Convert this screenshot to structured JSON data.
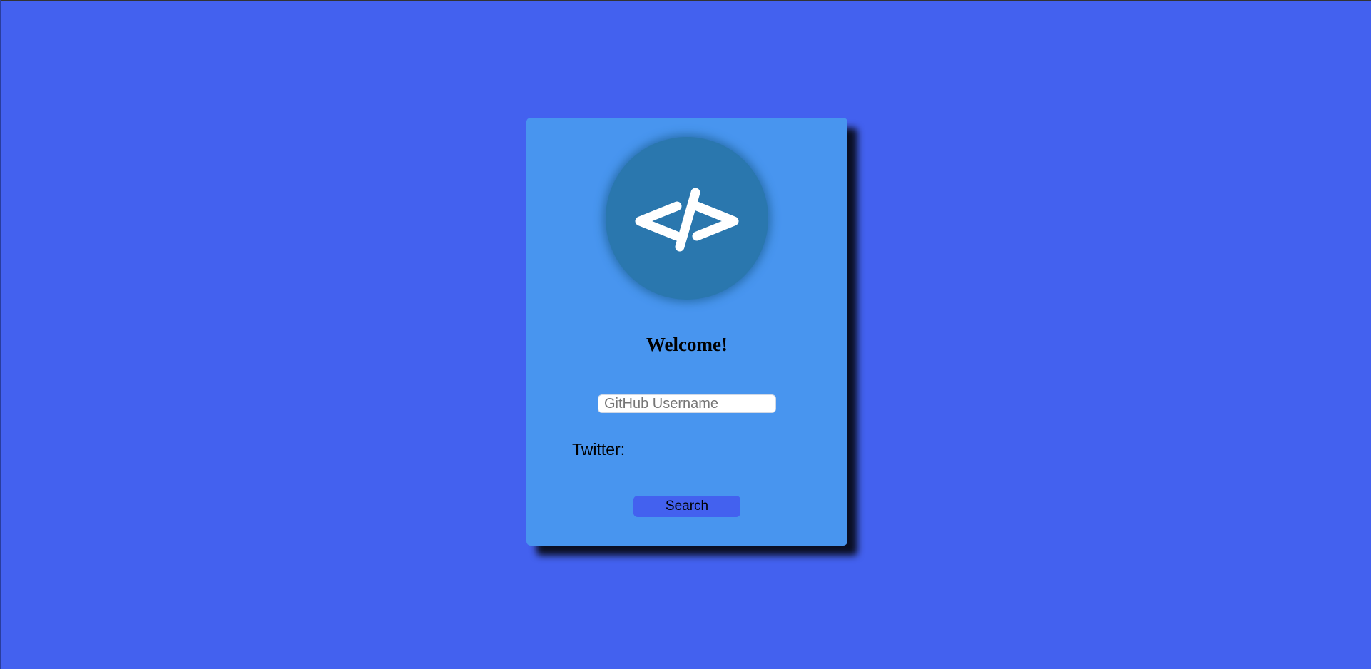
{
  "card": {
    "title": "Welcome!",
    "logo_icon": "code-brackets-icon",
    "username_placeholder": "GitHub Username",
    "username_value": "",
    "twitter_label": "Twitter:",
    "search_label": "Search"
  },
  "colors": {
    "page_background": "#4361ef",
    "card_background": "#4895ef",
    "logo_circle": "#2a77ae",
    "button_background": "#4361ef"
  }
}
